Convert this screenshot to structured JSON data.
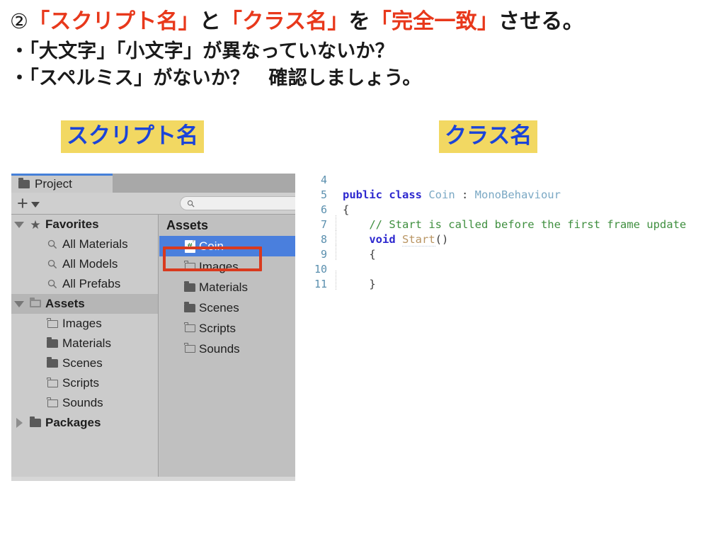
{
  "slide": {
    "heading": {
      "number": "②",
      "segments": [
        {
          "text": "「スクリプト名」",
          "color": "#e8381b"
        },
        {
          "text": "と",
          "color": "#1a1a1a"
        },
        {
          "text": "「クラス名」",
          "color": "#e8381b"
        },
        {
          "text": "を",
          "color": "#1a1a1a"
        },
        {
          "text": "「完全一致」",
          "color": "#e8381b"
        },
        {
          "text": "させる。",
          "color": "#1a1a1a"
        }
      ],
      "full_text": "②「スクリプト名」と「クラス名」を「完全一致」させる。"
    },
    "bullets": [
      "・「大文字」「小文字」が異なっていないか？",
      "・「スペルミス」がないか？　確認しましょう。"
    ],
    "captions": {
      "script_name": "スクリプト名",
      "class_name": "クラス名",
      "highlight_color": "#f2d862",
      "text_color": "#1b44d8"
    },
    "annotation_color": "#d93a1e"
  },
  "project_panel": {
    "tab": {
      "label": "Project",
      "icon": "folder-icon",
      "active": true,
      "accent_color": "#4580d8"
    },
    "toolbar": {
      "create_label": "+",
      "create_dropdown_icon": "chevron-down-icon",
      "search_placeholder": "",
      "search_value": "",
      "search_icon": "search-icon"
    },
    "tree": [
      {
        "label": "Favorites",
        "icon": "star-icon",
        "twisty": "down",
        "depth": 0,
        "bold": true,
        "highlight": false
      },
      {
        "label": "All Materials",
        "icon": "search-icon",
        "twisty": "none",
        "depth": 1,
        "bold": false,
        "highlight": false
      },
      {
        "label": "All Models",
        "icon": "search-icon",
        "twisty": "none",
        "depth": 1,
        "bold": false,
        "highlight": false
      },
      {
        "label": "All Prefabs",
        "icon": "search-icon",
        "twisty": "none",
        "depth": 1,
        "bold": false,
        "highlight": false
      },
      {
        "label": "Assets",
        "icon": "folder-open-icon",
        "twisty": "down",
        "depth": 0,
        "bold": true,
        "highlight": true
      },
      {
        "label": "Images",
        "icon": "folder-outline-icon",
        "twisty": "none",
        "depth": 1,
        "bold": false,
        "highlight": false
      },
      {
        "label": "Materials",
        "icon": "folder-filled-icon",
        "twisty": "none",
        "depth": 1,
        "bold": false,
        "highlight": false
      },
      {
        "label": "Scenes",
        "icon": "folder-filled-icon",
        "twisty": "none",
        "depth": 1,
        "bold": false,
        "highlight": false
      },
      {
        "label": "Scripts",
        "icon": "folder-outline-icon",
        "twisty": "none",
        "depth": 1,
        "bold": false,
        "highlight": false
      },
      {
        "label": "Sounds",
        "icon": "folder-outline-icon",
        "twisty": "none",
        "depth": 1,
        "bold": false,
        "highlight": false
      },
      {
        "label": "Packages",
        "icon": "folder-filled-icon",
        "twisty": "right",
        "depth": 0,
        "bold": true,
        "highlight": false
      }
    ],
    "list": {
      "header": "Assets",
      "selection_color": "#4a7fdd",
      "items": [
        {
          "label": "Coin",
          "icon": "csharp-file-icon",
          "selected": true,
          "annotated": true
        },
        {
          "label": "Images",
          "icon": "folder-outline-icon",
          "selected": false,
          "annotated": false
        },
        {
          "label": "Materials",
          "icon": "folder-filled-icon",
          "selected": false,
          "annotated": false
        },
        {
          "label": "Scenes",
          "icon": "folder-filled-icon",
          "selected": false,
          "annotated": false
        },
        {
          "label": "Scripts",
          "icon": "folder-outline-icon",
          "selected": false,
          "annotated": false
        },
        {
          "label": "Sounds",
          "icon": "folder-outline-icon",
          "selected": false,
          "annotated": false
        }
      ]
    }
  },
  "code_editor": {
    "lines": [
      {
        "number": "4",
        "guide": false,
        "tokens": []
      },
      {
        "number": "5",
        "guide": false,
        "tokens": [
          {
            "text": "public class ",
            "kind": "kw"
          },
          {
            "text": "Coin",
            "kind": "type"
          },
          {
            "text": " : ",
            "kind": "punct"
          },
          {
            "text": "MonoBehaviour",
            "kind": "type"
          }
        ]
      },
      {
        "number": "6",
        "guide": false,
        "tokens": [
          {
            "text": "{",
            "kind": "plain"
          }
        ]
      },
      {
        "number": "7",
        "guide": true,
        "tokens": [
          {
            "text": "    // Start is called before the first frame update",
            "kind": "comment"
          }
        ]
      },
      {
        "number": "8",
        "guide": true,
        "tokens": [
          {
            "text": "    ",
            "kind": "plain"
          },
          {
            "text": "void",
            "kind": "kw"
          },
          {
            "text": " ",
            "kind": "plain"
          },
          {
            "text": "Start",
            "kind": "method"
          },
          {
            "text": "()",
            "kind": "plain"
          }
        ]
      },
      {
        "number": "9",
        "guide": true,
        "tokens": [
          {
            "text": "    {",
            "kind": "plain"
          }
        ]
      },
      {
        "number": "10",
        "guide": true,
        "tokens": []
      },
      {
        "number": "11",
        "guide": true,
        "tokens": [
          {
            "text": "    }",
            "kind": "plain"
          }
        ]
      }
    ],
    "highlighted_identifier": "Coin"
  }
}
